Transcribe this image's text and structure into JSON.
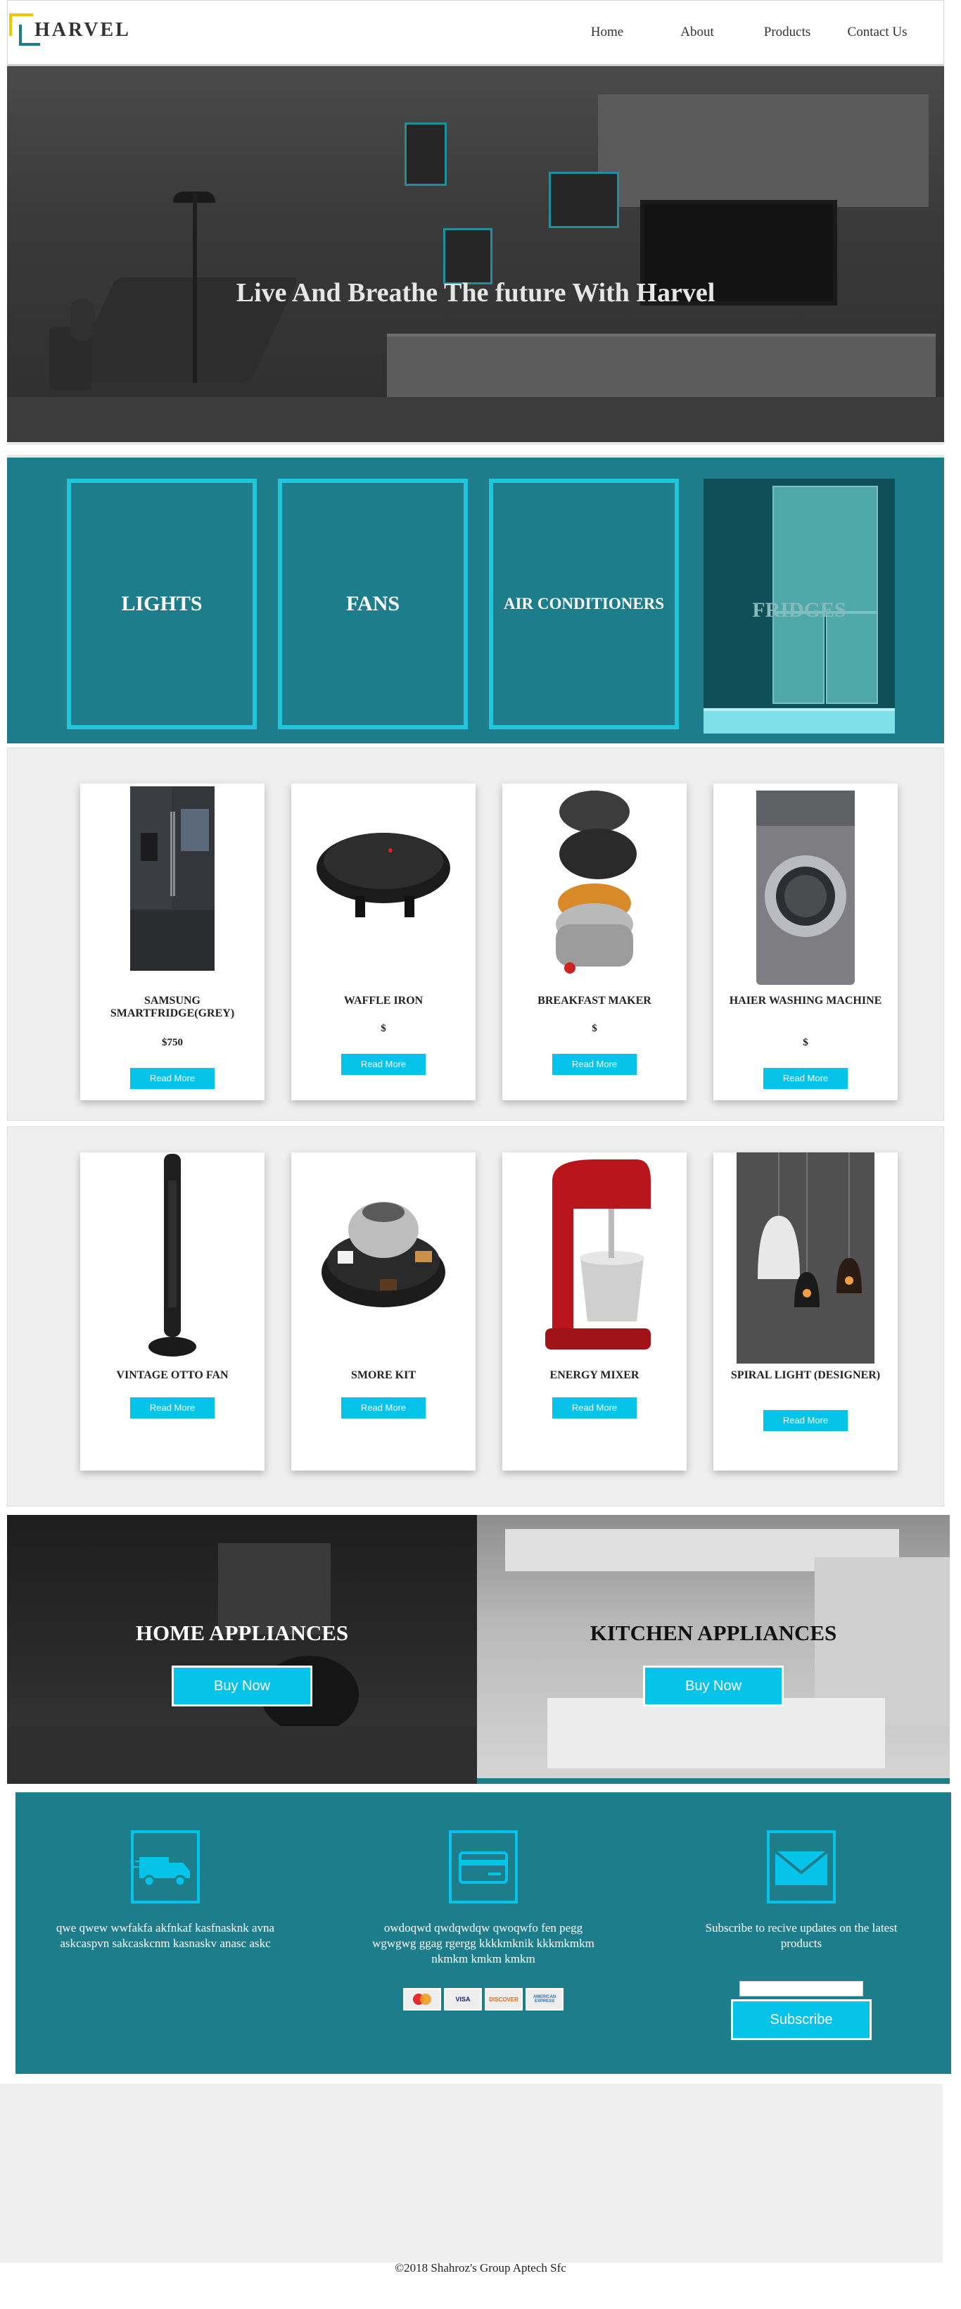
{
  "brand": {
    "name": "HARVEL"
  },
  "nav": {
    "items": [
      "Home",
      "About",
      "Products",
      "Contact Us"
    ]
  },
  "hero": {
    "title": "Live And Breathe The future With Harvel"
  },
  "categories": [
    "LIGHTS",
    "FANS",
    "AIR CONDITIONERS",
    "FRIDGES"
  ],
  "products_row1": [
    {
      "name": "SAMSUNG SMARTFRIDGE(Grey)",
      "price": "$750",
      "button": "Read More"
    },
    {
      "name": "WAFFLE IRON",
      "price": "$",
      "button": "Read More"
    },
    {
      "name": "BREAKFAST MAKER",
      "price": "$",
      "button": "Read More"
    },
    {
      "name": "HAIER WASHING MACHINE",
      "price": "$",
      "button": "Read More"
    }
  ],
  "products_row2": [
    {
      "name": "VINTAGE OTTO FAN",
      "button": "Read More"
    },
    {
      "name": "SMORE KIT",
      "button": "Read More"
    },
    {
      "name": "ENERGY MIXER",
      "button": "Read More"
    },
    {
      "name": "SPIRAL LIGHT (DESIGNER)",
      "button": "Read More"
    }
  ],
  "appliances": [
    {
      "title": "HOME APPLIANCES",
      "button": "Buy Now"
    },
    {
      "title": "KITCHEN APPLIANCES",
      "button": "Buy Now"
    }
  ],
  "info": {
    "delivery_text": "qwe qwew wwfakfa akfnkaf kasfnasknk avna askcaspvn sakcaskcnm kasnaskv anasc askc",
    "payment_text": "owdoqwd qwdqwdqw qwoqwfo fen pegg wgwgwg ggag rgergg kkkkmknik kkkmkmkm nkmkm kmkm kmkm",
    "payment_cards": [
      "VISA",
      "DISCOVER",
      "AMERICAN EXPRESS"
    ],
    "subscribe_text": "Subscribe to recive updates on the latest products",
    "subscribe_button": "Subscribe"
  },
  "footer": {
    "copyright": "©2018 Shahroz's Group Aptech Sfc"
  },
  "colors": {
    "teal": "#1d7d8a",
    "cyan": "#06c3ea",
    "accent_yellow": "#f2c600"
  }
}
